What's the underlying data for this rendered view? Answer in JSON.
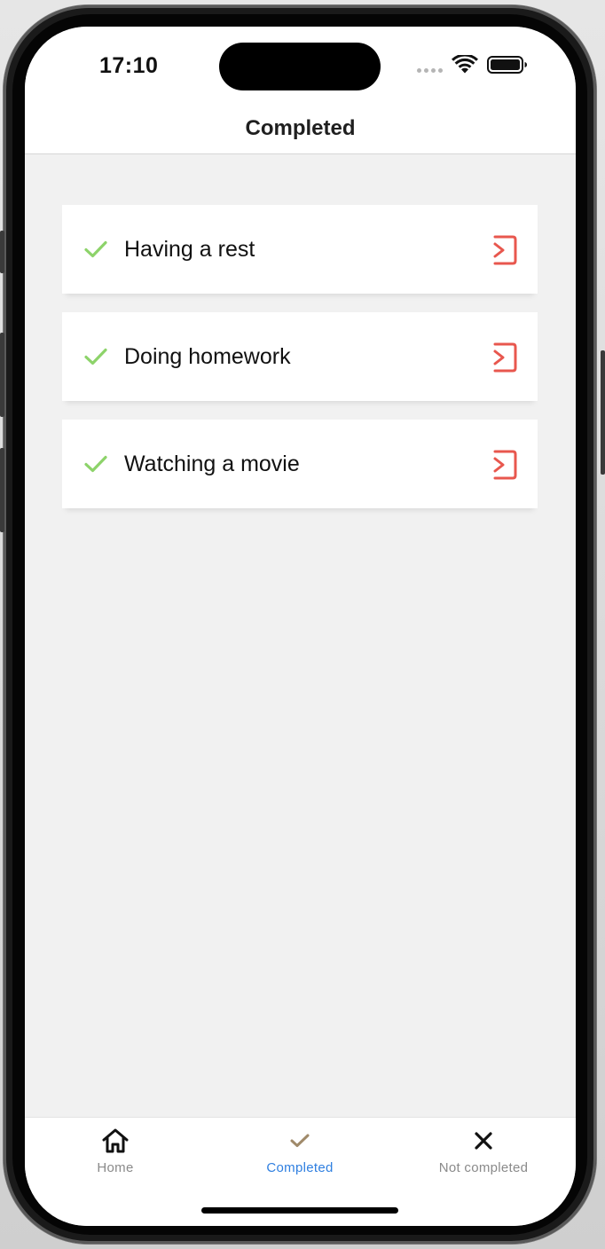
{
  "status_bar": {
    "time": "17:10"
  },
  "header": {
    "title": "Completed"
  },
  "tasks": [
    {
      "label": "Having a rest",
      "status_icon": "check-icon",
      "action_icon": "move-out-icon"
    },
    {
      "label": "Doing homework",
      "status_icon": "check-icon",
      "action_icon": "move-out-icon"
    },
    {
      "label": "Watching a movie",
      "status_icon": "check-icon",
      "action_icon": "move-out-icon"
    }
  ],
  "tab_bar": {
    "active_tab": "Completed",
    "tabs": [
      {
        "label": "Home",
        "icon": "home-icon"
      },
      {
        "label": "Completed",
        "icon": "check-icon"
      },
      {
        "label": "Not completed",
        "icon": "close-icon"
      }
    ]
  },
  "colors": {
    "check_green": "#8dd36a",
    "action_red": "#e8574e",
    "tab_active": "#2f7fe0",
    "tab_inactive": "#8a8a8a",
    "tab_check_brown": "#a08a6a",
    "screen_bg": "#f1f1f1"
  }
}
